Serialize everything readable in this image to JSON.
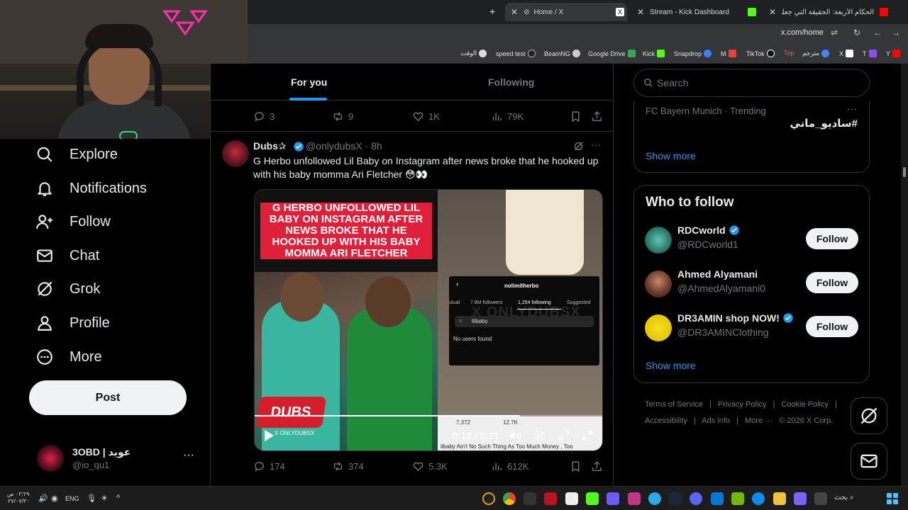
{
  "browser": {
    "tabs": [
      {
        "title": "Home / X",
        "active": true
      },
      {
        "title": "Stream - Kick Dashboard",
        "active": false
      },
      {
        "title": "الحكام الأربعة: الحقيقة التي جعلت \"...",
        "active": false
      }
    ],
    "new_tab_label": "+",
    "url": "x.com/home",
    "bookmarks": [
      "الوقت",
      "speed test",
      "BeamNG",
      "Google Drive",
      "Kick",
      "Snapdrop",
      "M",
      "TikTok",
      "Top",
      "مترجم",
      "X",
      "T",
      "Y"
    ]
  },
  "x_nav": {
    "items": [
      {
        "label": "Explore",
        "icon": "search-icon"
      },
      {
        "label": "Notifications",
        "icon": "bell-icon"
      },
      {
        "label": "Follow",
        "icon": "person-plus-icon"
      },
      {
        "label": "Chat",
        "icon": "envelope-icon"
      },
      {
        "label": "Grok",
        "icon": "grok-icon"
      },
      {
        "label": "Profile",
        "icon": "person-icon"
      },
      {
        "label": "More",
        "icon": "more-circle-icon"
      }
    ],
    "post_label": "Post",
    "account": {
      "name": "3OBD | عويد",
      "handle": "@io_qu1",
      "more": "···"
    }
  },
  "timeline": {
    "tabs": {
      "for_you": "For you",
      "following": "Following"
    },
    "prev_actions": {
      "replies": "3",
      "reposts": "9",
      "likes": "1K",
      "views": "79K"
    },
    "tweet": {
      "author": "Dubs✰",
      "handle_time": "@onlydubsX · 8h",
      "more": "···",
      "text": "G Herbo unfollowed Lil Baby on Instagram after news broke that he hooked up with his baby momma Ari Fletcher 😳👀",
      "media": {
        "headline": "G HERBO UNFOLLOWED LIL BABY ON INSTAGRAM AFTER NEWS BROKE THAT HE HOOKED UP WITH HIS BABY MOMMA ARI FLETCHER",
        "ig_username": "nolimitherbo",
        "ig_tabs": [
          "utual",
          "7.8M followers",
          "1,254 following",
          "Suggested"
        ],
        "ig_search": "lilbaby",
        "ig_no_users": "No users found",
        "ig_watermark": "X ONLYDUBSX",
        "ig_stats": [
          "7,372",
          "12.7K"
        ],
        "logo": "DUBS",
        "logo_watermark": "X ONLYDUBSX",
        "caption_strip": "ilbaby Ain't No Such Thing As Too Much Money , Too",
        "video_time": "0:16 / 0:21",
        "progress": 0.76
      },
      "actions": {
        "replies": "174",
        "reposts": "374",
        "likes": "5.3K",
        "views": "612K"
      }
    }
  },
  "sidebar": {
    "search_placeholder": "Search",
    "trend": {
      "meta": "FC Bayern Munich · Trending",
      "tag": "#ساديو_ماني",
      "more": "···",
      "show_more": "Show more"
    },
    "who_to_follow": {
      "title": "Who to follow",
      "users": [
        {
          "name": "RDCworld",
          "handle": "@RDCworld1",
          "verified": true,
          "button": "Follow"
        },
        {
          "name": "Ahmed Alyamani",
          "handle": "@AhmedAlyamani0",
          "verified": false,
          "button": "Follow"
        },
        {
          "name": "DR3AMIN shop NOW!",
          "handle": "@DR3AMINClothing",
          "verified": true,
          "button": "Follow"
        }
      ],
      "show_more": "Show more"
    },
    "footer": [
      "Terms of Service",
      "|",
      "Privacy Policy",
      "|",
      "Cookie Policy",
      "|",
      "Accessibility",
      "|",
      "Ads info",
      "|",
      "More ···",
      "© 2026 X Corp."
    ]
  },
  "taskbar": {
    "time": "٠٣:٢٩ ص",
    "date": "٢٧/٠٧/٣٠",
    "lang": "ENG",
    "search": "بحث"
  },
  "colors": {
    "accent": "#1d9bf0",
    "background": "#000000",
    "text": "#e7e9ea",
    "muted": "#71767b",
    "border": "#2f3336"
  }
}
